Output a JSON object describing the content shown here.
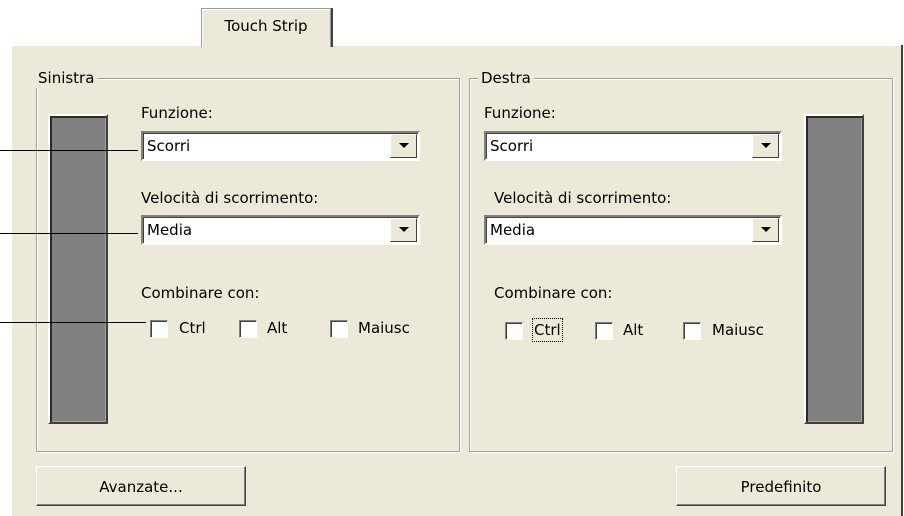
{
  "tab": {
    "label": "Touch Strip"
  },
  "left_group": {
    "legend": "Sinistra",
    "function_label": "Funzione:",
    "function_value": "Scorri",
    "speed_label": "Velocità di scorrimento:",
    "speed_value": "Media",
    "combine_label": "Combinare con:",
    "checkboxes": [
      {
        "label": "Ctrl",
        "checked": false
      },
      {
        "label": "Alt",
        "checked": false
      },
      {
        "label": "Maiusc",
        "checked": false
      }
    ]
  },
  "right_group": {
    "legend": "Destra",
    "function_label": "Funzione:",
    "function_value": "Scorri",
    "speed_label": "Velocità di scorrimento:",
    "speed_value": "Media",
    "combine_label": "Combinare con:",
    "checkboxes": [
      {
        "label": "Ctrl",
        "checked": false,
        "focused": true
      },
      {
        "label": "Alt",
        "checked": false
      },
      {
        "label": "Maiusc",
        "checked": false
      }
    ]
  },
  "buttons": {
    "advanced": "Avanzate...",
    "default": "Predefinito"
  },
  "colors": {
    "dialog_bg": "#ece9d8",
    "strip": "#808080"
  }
}
